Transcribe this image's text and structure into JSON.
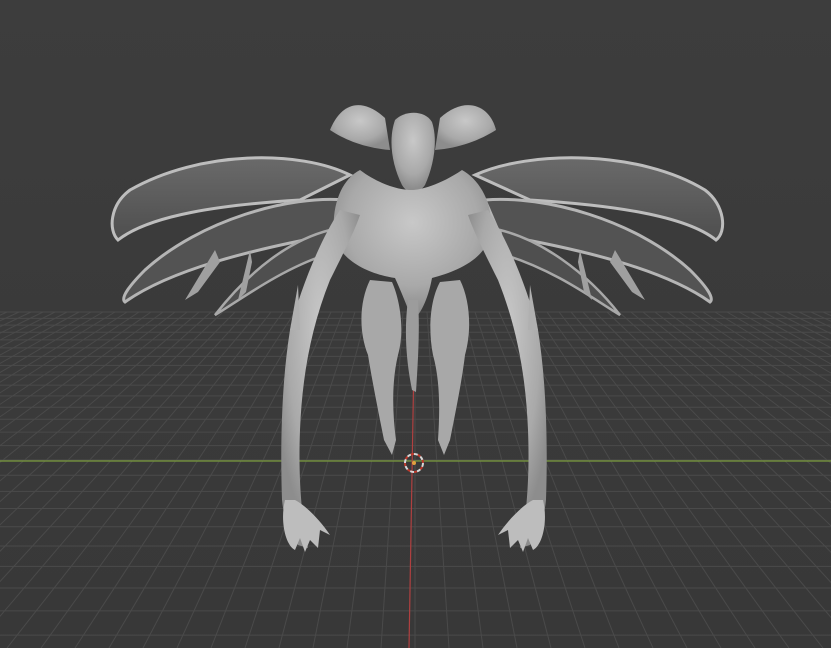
{
  "viewport": {
    "background": "#3a3a3a",
    "grid_color": "#4a4a4a",
    "x_axis_color": "#7a9a3c",
    "y_axis_color": "#b04040",
    "mesh_color": "#b8b8b8",
    "origin_icon": "object-origin-icon",
    "cursor_icon": "3d-cursor-icon"
  }
}
